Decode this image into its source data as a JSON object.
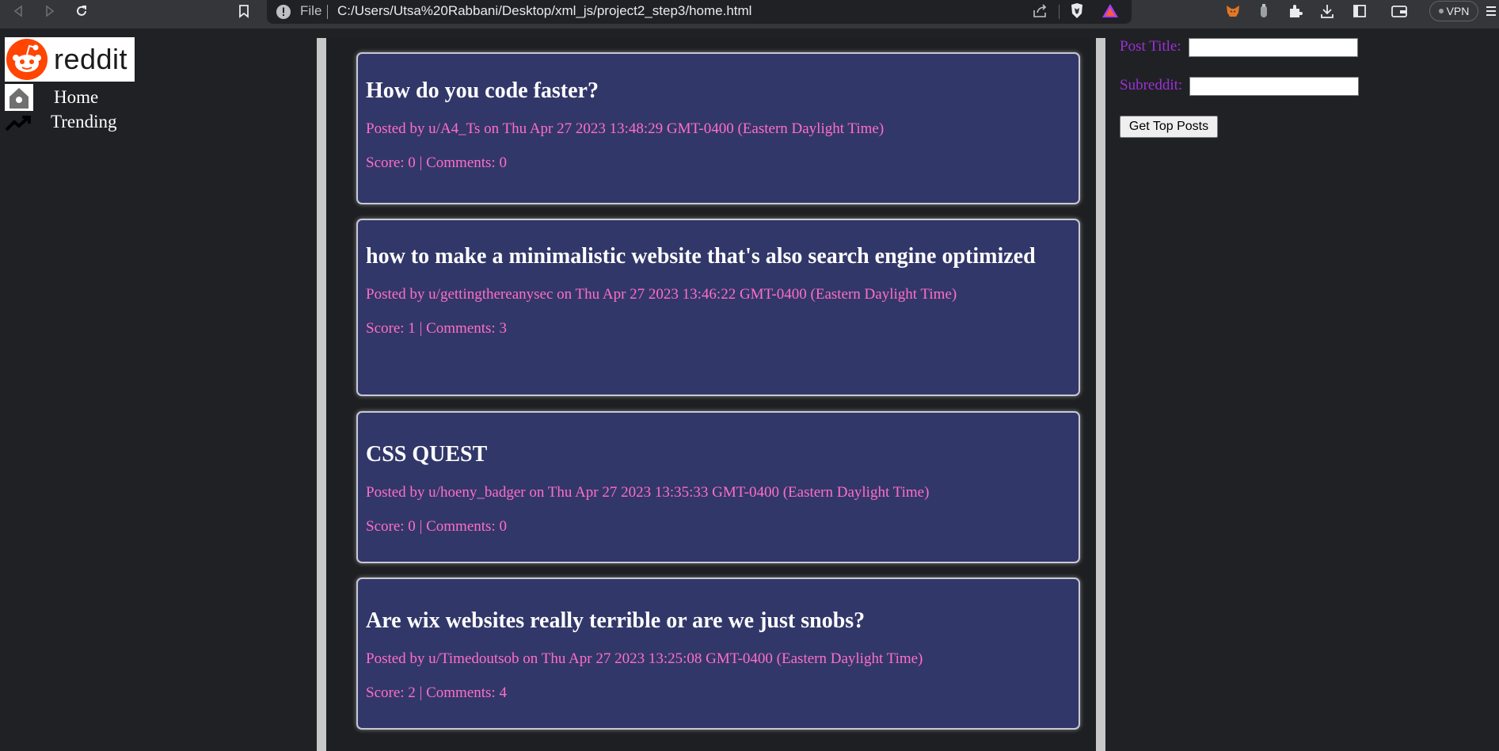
{
  "browser": {
    "file_label": "File",
    "url": "C:/Users/Utsa%20Rabbani/Desktop/xml_js/project2_step3/home.html",
    "vpn_label": "VPN",
    "icons": [
      "back-icon",
      "forward-icon",
      "reload-icon",
      "bookmark-icon",
      "info-icon",
      "share-icon",
      "brave-shield-icon",
      "brave-rewards-icon",
      "metamask-icon",
      "extension-icon",
      "puzzle-icon",
      "download-icon",
      "sidebar-icon",
      "wallet-icon",
      "menu-icon"
    ]
  },
  "sidebar": {
    "logo_text": "reddit",
    "items": [
      {
        "label": "Home",
        "icon": "home-icon"
      },
      {
        "label": "Trending",
        "icon": "trending-icon"
      }
    ]
  },
  "posts": [
    {
      "title": "How do you code faster?",
      "meta": "Posted by u/A4_Ts on Thu Apr 27 2023 13:48:29 GMT-0400 (Eastern Daylight Time)",
      "score": "Score: 0 | Comments: 0"
    },
    {
      "title": "how to make a minimalistic website that's also search engine optimized",
      "meta": "Posted by u/gettingthereanysec on Thu Apr 27 2023 13:46:22 GMT-0400 (Eastern Daylight Time)",
      "score": "Score: 1 | Comments: 3"
    },
    {
      "title": "CSS QUEST",
      "meta": "Posted by u/hoeny_badger on Thu Apr 27 2023 13:35:33 GMT-0400 (Eastern Daylight Time)",
      "score": "Score: 0 | Comments: 0"
    },
    {
      "title": "Are wix websites really terrible or are we just snobs?",
      "meta": "Posted by u/Timedoutsob on Thu Apr 27 2023 13:25:08 GMT-0400 (Eastern Daylight Time)",
      "score": "Score: 2 | Comments: 4"
    }
  ],
  "form": {
    "post_title_label": "Post Title:",
    "post_title_value": "",
    "subreddit_label": "Subreddit:",
    "subreddit_value": "",
    "submit_label": "Get Top Posts"
  },
  "colors": {
    "page_bg": "#202124",
    "card_bg": "#323769",
    "meta_text": "#ff6ec7",
    "form_label": "#9b30d9",
    "reddit_orange": "#ff4500"
  }
}
